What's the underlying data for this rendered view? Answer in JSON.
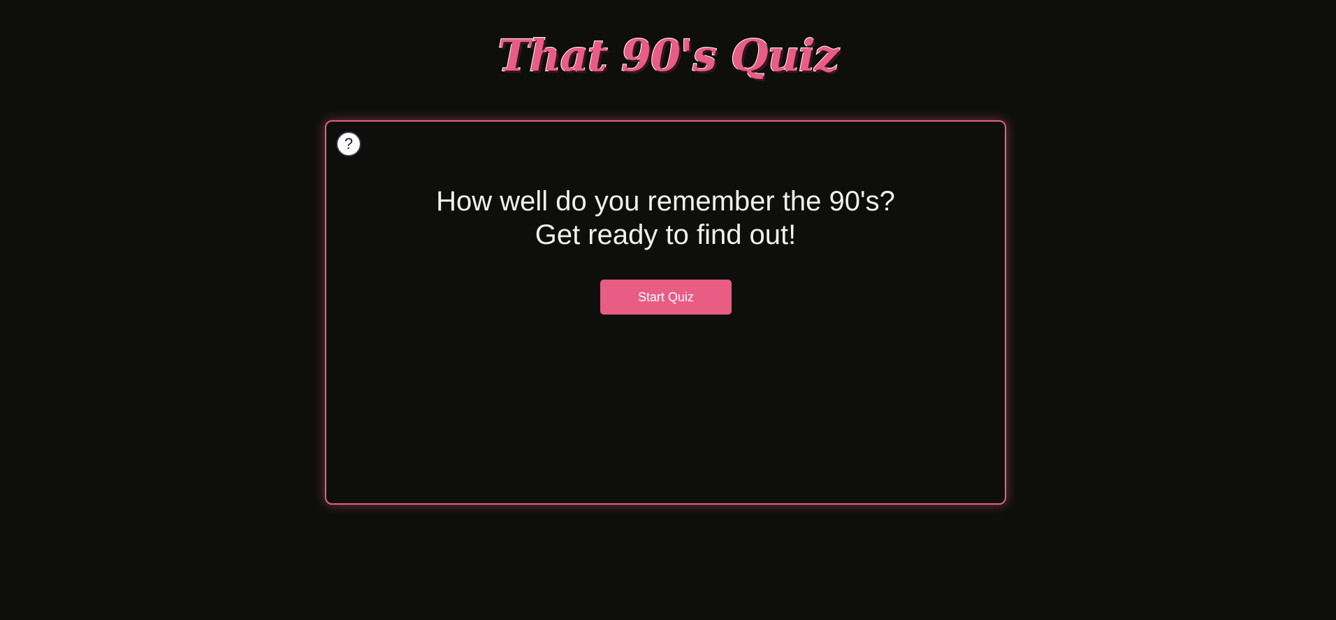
{
  "header": {
    "title": "That 90's Quiz"
  },
  "card": {
    "help_label": "?",
    "intro_line1": "How well do you remember the 90's?",
    "intro_line2": "Get ready to find out!",
    "start_label": "Start Quiz"
  },
  "colors": {
    "accent": "#e85d84",
    "background": "#0e0f0c",
    "text": "#f1f1f1"
  },
  "icons": {
    "help": "question-mark-icon"
  }
}
